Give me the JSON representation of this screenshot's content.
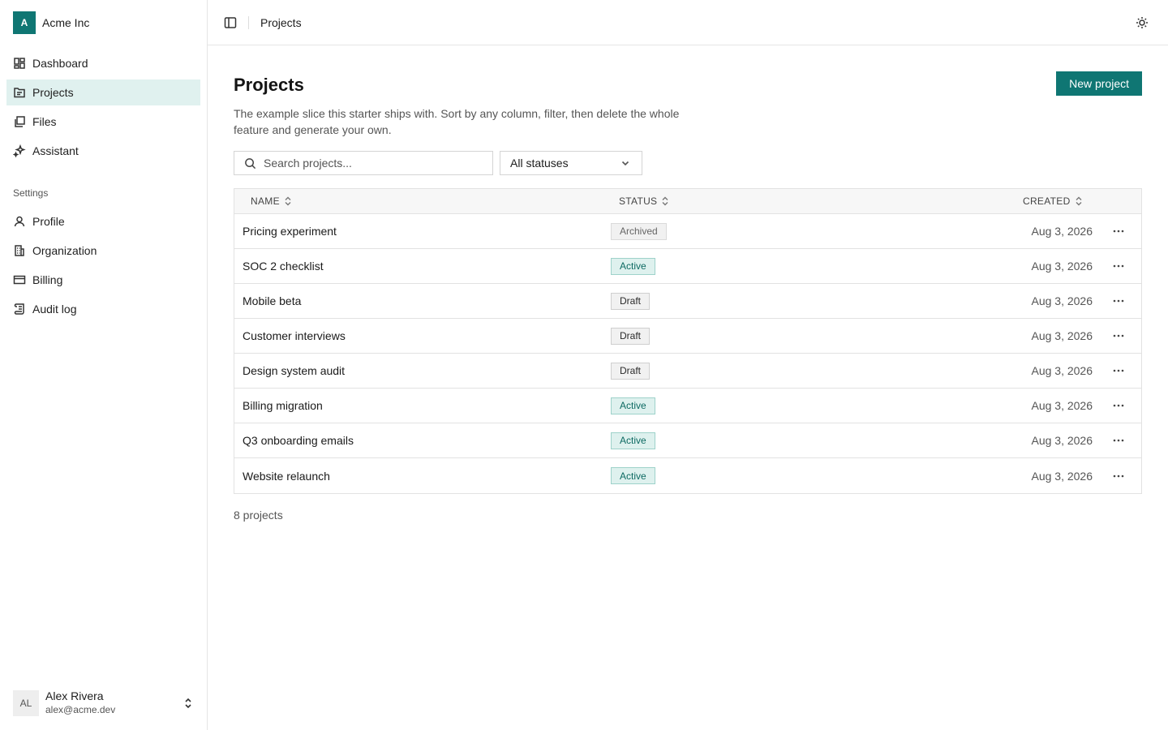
{
  "brand": {
    "logo_letter": "A",
    "name": "Acme Inc"
  },
  "nav": {
    "items": [
      {
        "label": "Dashboard",
        "icon": "dashboard-icon",
        "active": false
      },
      {
        "label": "Projects",
        "icon": "folder-icon",
        "active": true
      },
      {
        "label": "Files",
        "icon": "files-icon",
        "active": false
      },
      {
        "label": "Assistant",
        "icon": "sparkles-icon",
        "active": false
      }
    ],
    "settings_label": "Settings",
    "settings_items": [
      {
        "label": "Profile",
        "icon": "user-icon"
      },
      {
        "label": "Organization",
        "icon": "building-icon"
      },
      {
        "label": "Billing",
        "icon": "credit-card-icon"
      },
      {
        "label": "Audit log",
        "icon": "scroll-icon"
      }
    ]
  },
  "user": {
    "initials": "AL",
    "name": "Alex Rivera",
    "email": "alex@acme.dev"
  },
  "topbar": {
    "breadcrumb": "Projects"
  },
  "page": {
    "title": "Projects",
    "description": "The example slice this starter ships with. Sort by any column, filter, then delete the whole feature and generate your own.",
    "new_button": "New project"
  },
  "filters": {
    "search_placeholder": "Search projects...",
    "status_value": "All statuses"
  },
  "table": {
    "columns": {
      "name": "NAME",
      "status": "STATUS",
      "created": "CREATED"
    },
    "rows": [
      {
        "name": "Pricing experiment",
        "status": "Archived",
        "status_kind": "archived",
        "created": "Aug 3, 2026"
      },
      {
        "name": "SOC 2 checklist",
        "status": "Active",
        "status_kind": "active",
        "created": "Aug 3, 2026"
      },
      {
        "name": "Mobile beta",
        "status": "Draft",
        "status_kind": "draft",
        "created": "Aug 3, 2026"
      },
      {
        "name": "Customer interviews",
        "status": "Draft",
        "status_kind": "draft",
        "created": "Aug 3, 2026"
      },
      {
        "name": "Design system audit",
        "status": "Draft",
        "status_kind": "draft",
        "created": "Aug 3, 2026"
      },
      {
        "name": "Billing migration",
        "status": "Active",
        "status_kind": "active",
        "created": "Aug 3, 2026"
      },
      {
        "name": "Q3 onboarding emails",
        "status": "Active",
        "status_kind": "active",
        "created": "Aug 3, 2026"
      },
      {
        "name": "Website relaunch",
        "status": "Active",
        "status_kind": "active",
        "created": "Aug 3, 2026"
      }
    ]
  },
  "footer": {
    "count": "8 projects"
  },
  "colors": {
    "accent": "#0f7673",
    "active_nav_bg": "#e0f1ef",
    "active_badge_bg": "#def1ee",
    "active_badge_text": "#0d6a62"
  }
}
